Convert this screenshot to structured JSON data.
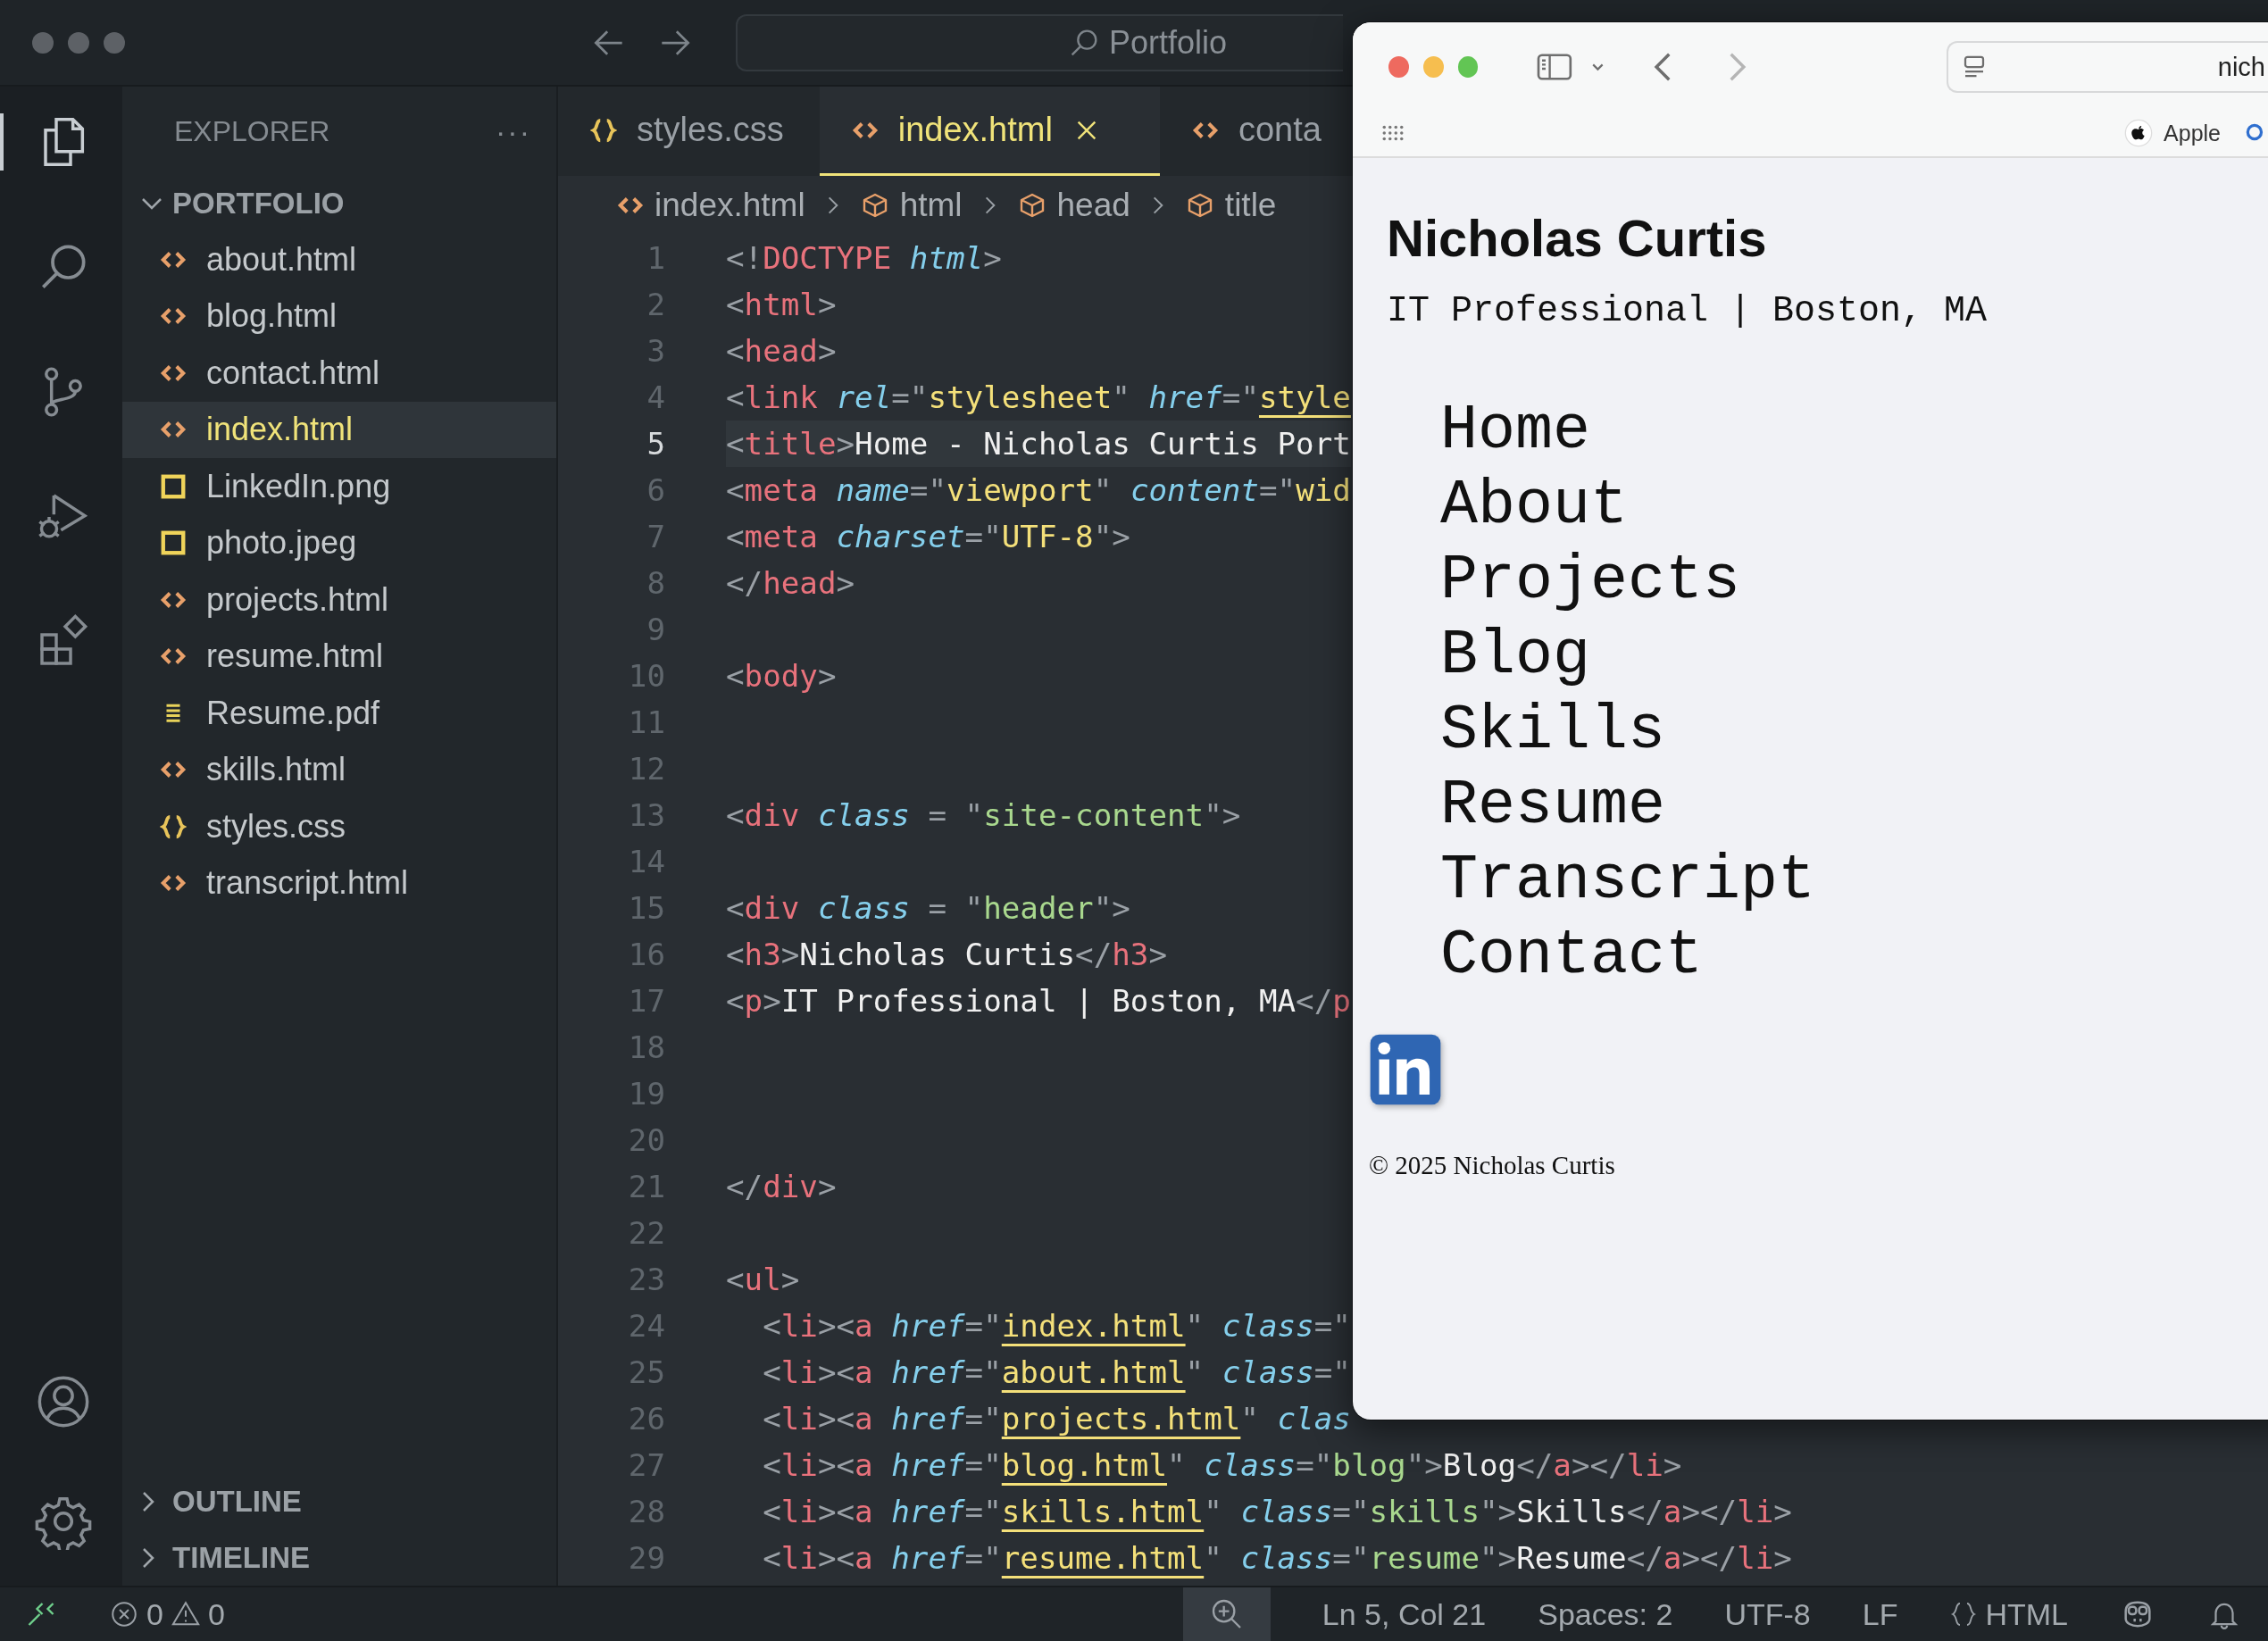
{
  "titlebar": {
    "search": "Portfolio"
  },
  "activity_bar": [
    {
      "selected": true
    },
    {
      "selected": false
    },
    {
      "selected": false
    },
    {
      "selected": false
    },
    {
      "selected": false
    }
  ],
  "sidebar": {
    "title": "EXPLORER",
    "more": "···",
    "folder": "PORTFOLIO",
    "expanded": true,
    "files": [
      {
        "name": "about.html",
        "kind": "html",
        "selected": false
      },
      {
        "name": "blog.html",
        "kind": "html",
        "selected": false
      },
      {
        "name": "contact.html",
        "kind": "html",
        "selected": false
      },
      {
        "name": "index.html",
        "kind": "html",
        "selected": true
      },
      {
        "name": "LinkedIn.png",
        "kind": "image",
        "selected": false
      },
      {
        "name": "photo.jpeg",
        "kind": "image",
        "selected": false
      },
      {
        "name": "projects.html",
        "kind": "html",
        "selected": false
      },
      {
        "name": "resume.html",
        "kind": "html",
        "selected": false
      },
      {
        "name": "Resume.pdf",
        "kind": "pdf",
        "selected": false
      },
      {
        "name": "skills.html",
        "kind": "html",
        "selected": false
      },
      {
        "name": "styles.css",
        "kind": "css",
        "selected": false
      },
      {
        "name": "transcript.html",
        "kind": "html",
        "selected": false
      }
    ],
    "sections": [
      {
        "label": "OUTLINE",
        "expanded": false
      },
      {
        "label": "TIMELINE",
        "expanded": false
      }
    ]
  },
  "tabs": [
    {
      "label": "styles.css",
      "kind": "css",
      "selected": false
    },
    {
      "label": "index.html",
      "kind": "html",
      "selected": true
    },
    {
      "label": "conta",
      "kind": "html",
      "selected": false
    }
  ],
  "breadcrumb": [
    {
      "label": "index.html",
      "kind": "html"
    },
    {
      "label": "html",
      "kind": "element"
    },
    {
      "label": "head",
      "kind": "element"
    },
    {
      "label": "title",
      "kind": "element"
    }
  ],
  "code": [
    {
      "number": "1",
      "current": false,
      "tokens": [
        {
          "kind": "p",
          "text": "<!"
        },
        {
          "kind": "tag",
          "text": "DOCTYPE"
        },
        {
          "kind": "attr",
          "text": " html"
        },
        {
          "kind": "p",
          "text": ">"
        }
      ]
    },
    {
      "number": "2",
      "current": false,
      "tokens": [
        {
          "kind": "p",
          "text": "<"
        },
        {
          "kind": "tag",
          "text": "html"
        },
        {
          "kind": "p",
          "text": ">"
        }
      ]
    },
    {
      "number": "3",
      "current": false,
      "tokens": [
        {
          "kind": "p",
          "text": "<"
        },
        {
          "kind": "tag",
          "text": "head"
        },
        {
          "kind": "p",
          "text": ">"
        }
      ]
    },
    {
      "number": "4",
      "current": false,
      "tokens": [
        {
          "kind": "p",
          "text": "<"
        },
        {
          "kind": "tag",
          "text": "link"
        },
        {
          "kind": "attr",
          "text": " rel"
        },
        {
          "kind": "p",
          "text": "=\""
        },
        {
          "kind": "str",
          "text": "stylesheet"
        },
        {
          "kind": "p",
          "text": "\" "
        },
        {
          "kind": "attr",
          "text": "href"
        },
        {
          "kind": "p",
          "text": "=\""
        },
        {
          "kind": "link",
          "text": "style"
        }
      ]
    },
    {
      "number": "5",
      "current": true,
      "tokens": [
        {
          "kind": "p",
          "text": "<"
        },
        {
          "kind": "tag",
          "text": "title"
        },
        {
          "kind": "p",
          "text": ">"
        },
        {
          "kind": "txt",
          "text": "Home - Nicholas Curtis Port"
        }
      ]
    },
    {
      "number": "6",
      "current": false,
      "tokens": [
        {
          "kind": "p",
          "text": "<"
        },
        {
          "kind": "tag",
          "text": "meta"
        },
        {
          "kind": "attr",
          "text": " name"
        },
        {
          "kind": "p",
          "text": "=\""
        },
        {
          "kind": "str",
          "text": "viewport"
        },
        {
          "kind": "p",
          "text": "\" "
        },
        {
          "kind": "attr",
          "text": "content"
        },
        {
          "kind": "p",
          "text": "=\""
        },
        {
          "kind": "str",
          "text": "wid"
        }
      ]
    },
    {
      "number": "7",
      "current": false,
      "tokens": [
        {
          "kind": "p",
          "text": "<"
        },
        {
          "kind": "tag",
          "text": "meta"
        },
        {
          "kind": "attr",
          "text": " charset"
        },
        {
          "kind": "p",
          "text": "=\""
        },
        {
          "kind": "str",
          "text": "UTF-8"
        },
        {
          "kind": "p",
          "text": "\">"
        }
      ]
    },
    {
      "number": "8",
      "current": false,
      "tokens": [
        {
          "kind": "p",
          "text": "</"
        },
        {
          "kind": "tag",
          "text": "head"
        },
        {
          "kind": "p",
          "text": ">"
        }
      ]
    },
    {
      "number": "9",
      "current": false
    },
    {
      "number": "10",
      "current": false,
      "tokens": [
        {
          "kind": "p",
          "text": "<"
        },
        {
          "kind": "tag",
          "text": "body"
        },
        {
          "kind": "p",
          "text": ">"
        }
      ]
    },
    {
      "number": "11",
      "current": false
    },
    {
      "number": "12",
      "current": false
    },
    {
      "number": "13",
      "current": false,
      "tokens": [
        {
          "kind": "p",
          "text": "<"
        },
        {
          "kind": "tag",
          "text": "div"
        },
        {
          "kind": "attr",
          "text": " class"
        },
        {
          "kind": "p",
          "text": " = \""
        },
        {
          "kind": "val",
          "text": "site-content"
        },
        {
          "kind": "p",
          "text": "\">"
        }
      ]
    },
    {
      "number": "14",
      "current": false
    },
    {
      "number": "15",
      "current": false,
      "tokens": [
        {
          "kind": "p",
          "text": "<"
        },
        {
          "kind": "tag",
          "text": "div"
        },
        {
          "kind": "attr",
          "text": " class"
        },
        {
          "kind": "p",
          "text": " = \""
        },
        {
          "kind": "val",
          "text": "header"
        },
        {
          "kind": "p",
          "text": "\">"
        }
      ]
    },
    {
      "number": "16",
      "current": false,
      "tokens": [
        {
          "kind": "p",
          "text": "<"
        },
        {
          "kind": "tag",
          "text": "h3"
        },
        {
          "kind": "p",
          "text": ">"
        },
        {
          "kind": "txt",
          "text": "Nicholas Curtis"
        },
        {
          "kind": "p",
          "text": "</"
        },
        {
          "kind": "tag",
          "text": "h3"
        },
        {
          "kind": "p",
          "text": ">"
        }
      ]
    },
    {
      "number": "17",
      "current": false,
      "tokens": [
        {
          "kind": "p",
          "text": "<"
        },
        {
          "kind": "tag",
          "text": "p"
        },
        {
          "kind": "p",
          "text": ">"
        },
        {
          "kind": "txt",
          "text": "IT Professional | Boston, MA"
        },
        {
          "kind": "p",
          "text": "</"
        },
        {
          "kind": "tag",
          "text": "p"
        }
      ]
    },
    {
      "number": "18",
      "current": false
    },
    {
      "number": "19",
      "current": false
    },
    {
      "number": "20",
      "current": false
    },
    {
      "number": "21",
      "current": false,
      "tokens": [
        {
          "kind": "p",
          "text": "</"
        },
        {
          "kind": "tag",
          "text": "div"
        },
        {
          "kind": "p",
          "text": ">"
        }
      ]
    },
    {
      "number": "22",
      "current": false
    },
    {
      "number": "23",
      "current": false,
      "tokens": [
        {
          "kind": "p",
          "text": "<"
        },
        {
          "kind": "tag",
          "text": "ul"
        },
        {
          "kind": "p",
          "text": ">"
        }
      ]
    },
    {
      "number": "24",
      "current": false,
      "tokens": [
        {
          "kind": "p",
          "text": "  <"
        },
        {
          "kind": "tag",
          "text": "li"
        },
        {
          "kind": "p",
          "text": "><"
        },
        {
          "kind": "tag",
          "text": "a"
        },
        {
          "kind": "attr",
          "text": " href"
        },
        {
          "kind": "p",
          "text": "=\""
        },
        {
          "kind": "link",
          "text": "index.html"
        },
        {
          "kind": "p",
          "text": "\" "
        },
        {
          "kind": "attr",
          "text": "class"
        },
        {
          "kind": "p",
          "text": "=\""
        }
      ]
    },
    {
      "number": "25",
      "current": false,
      "tokens": [
        {
          "kind": "p",
          "text": "  <"
        },
        {
          "kind": "tag",
          "text": "li"
        },
        {
          "kind": "p",
          "text": "><"
        },
        {
          "kind": "tag",
          "text": "a"
        },
        {
          "kind": "attr",
          "text": " href"
        },
        {
          "kind": "p",
          "text": "=\""
        },
        {
          "kind": "link",
          "text": "about.html"
        },
        {
          "kind": "p",
          "text": "\" "
        },
        {
          "kind": "attr",
          "text": "class"
        },
        {
          "kind": "p",
          "text": "=\""
        }
      ]
    },
    {
      "number": "26",
      "current": false,
      "tokens": [
        {
          "kind": "p",
          "text": "  <"
        },
        {
          "kind": "tag",
          "text": "li"
        },
        {
          "kind": "p",
          "text": "><"
        },
        {
          "kind": "tag",
          "text": "a"
        },
        {
          "kind": "attr",
          "text": " href"
        },
        {
          "kind": "p",
          "text": "=\""
        },
        {
          "kind": "link",
          "text": "projects.html"
        },
        {
          "kind": "p",
          "text": "\" "
        },
        {
          "kind": "attr",
          "text": "clas"
        }
      ]
    },
    {
      "number": "27",
      "current": false,
      "tokens": [
        {
          "kind": "p",
          "text": "  <"
        },
        {
          "kind": "tag",
          "text": "li"
        },
        {
          "kind": "p",
          "text": "><"
        },
        {
          "kind": "tag",
          "text": "a"
        },
        {
          "kind": "attr",
          "text": " href"
        },
        {
          "kind": "p",
          "text": "=\""
        },
        {
          "kind": "link",
          "text": "blog.html"
        },
        {
          "kind": "p",
          "text": "\" "
        },
        {
          "kind": "attr",
          "text": "class"
        },
        {
          "kind": "p",
          "text": "=\""
        },
        {
          "kind": "val",
          "text": "blog"
        },
        {
          "kind": "p",
          "text": "\">"
        },
        {
          "kind": "txt",
          "text": "Blog"
        },
        {
          "kind": "p",
          "text": "</"
        },
        {
          "kind": "tag",
          "text": "a"
        },
        {
          "kind": "p",
          "text": "></"
        },
        {
          "kind": "tag",
          "text": "li"
        },
        {
          "kind": "p",
          "text": ">"
        }
      ]
    },
    {
      "number": "28",
      "current": false,
      "tokens": [
        {
          "kind": "p",
          "text": "  <"
        },
        {
          "kind": "tag",
          "text": "li"
        },
        {
          "kind": "p",
          "text": "><"
        },
        {
          "kind": "tag",
          "text": "a"
        },
        {
          "kind": "attr",
          "text": " href"
        },
        {
          "kind": "p",
          "text": "=\""
        },
        {
          "kind": "link",
          "text": "skills.html"
        },
        {
          "kind": "p",
          "text": "\" "
        },
        {
          "kind": "attr",
          "text": "class"
        },
        {
          "kind": "p",
          "text": "=\""
        },
        {
          "kind": "val",
          "text": "skills"
        },
        {
          "kind": "p",
          "text": "\">"
        },
        {
          "kind": "txt",
          "text": "Skills"
        },
        {
          "kind": "p",
          "text": "</"
        },
        {
          "kind": "tag",
          "text": "a"
        },
        {
          "kind": "p",
          "text": "></"
        },
        {
          "kind": "tag",
          "text": "li"
        },
        {
          "kind": "p",
          "text": ">"
        }
      ]
    },
    {
      "number": "29",
      "current": false,
      "tokens": [
        {
          "kind": "p",
          "text": "  <"
        },
        {
          "kind": "tag",
          "text": "li"
        },
        {
          "kind": "p",
          "text": "><"
        },
        {
          "kind": "tag",
          "text": "a"
        },
        {
          "kind": "attr",
          "text": " href"
        },
        {
          "kind": "p",
          "text": "=\""
        },
        {
          "kind": "link",
          "text": "resume.html"
        },
        {
          "kind": "p",
          "text": "\" "
        },
        {
          "kind": "attr",
          "text": "class"
        },
        {
          "kind": "p",
          "text": "=\""
        },
        {
          "kind": "val",
          "text": "resume"
        },
        {
          "kind": "p",
          "text": "\">"
        },
        {
          "kind": "txt",
          "text": "Resume"
        },
        {
          "kind": "p",
          "text": "</"
        },
        {
          "kind": "tag",
          "text": "a"
        },
        {
          "kind": "p",
          "text": "></"
        },
        {
          "kind": "tag",
          "text": "li"
        },
        {
          "kind": "p",
          "text": ">"
        }
      ]
    }
  ],
  "status_bar": {
    "errors": "0",
    "warnings": "0",
    "position": "Ln 5, Col 21",
    "spaces": "Spaces: 2",
    "encoding": "UTF-8",
    "eol": "LF",
    "language": "HTML"
  },
  "browser": {
    "address": "nich",
    "bookmark": "Apple",
    "page": {
      "name": "Nicholas Curtis",
      "subtitle": "IT Professional | Boston, MA",
      "nav": [
        "Home",
        "About",
        "Projects",
        "Blog",
        "Skills",
        "Resume",
        "Transcript",
        "Contact"
      ],
      "footer": "© 2025 Nicholas Curtis"
    }
  }
}
